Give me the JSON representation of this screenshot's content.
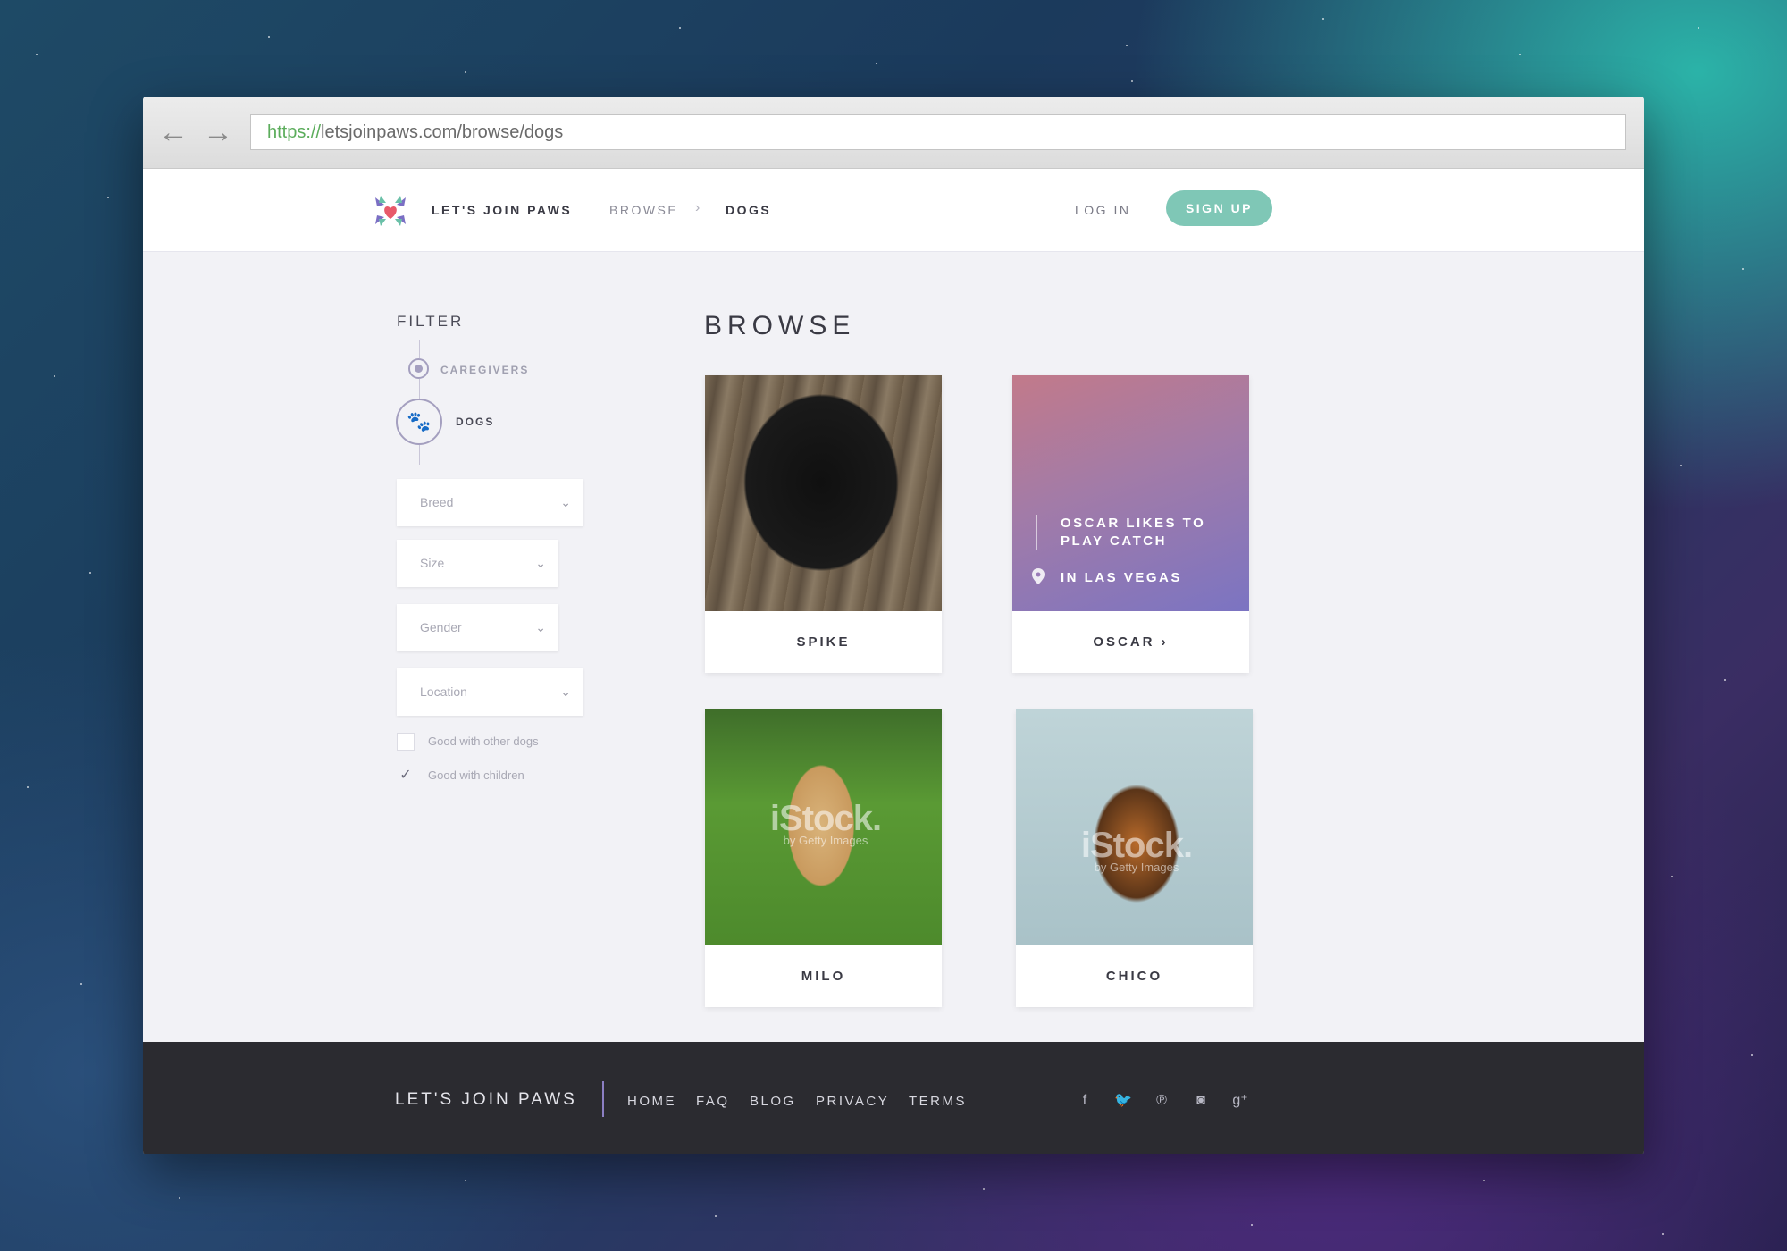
{
  "browser": {
    "url_scheme": "https://",
    "url_rest": "letsjoinpaws.com/browse/dogs"
  },
  "header": {
    "brand": "LET'S JOIN PAWS",
    "breadcrumb": [
      "BROWSE",
      "DOGS"
    ],
    "login": "LOG IN",
    "signup": "SIGN UP"
  },
  "filter": {
    "title": "FILTER",
    "steps": [
      "CAREGIVERS",
      "DOGS"
    ],
    "selects": {
      "breed": "Breed",
      "size": "Size",
      "gender": "Gender",
      "location": "Location"
    },
    "checkboxes": [
      {
        "label": "Good with other dogs",
        "checked": false
      },
      {
        "label": "Good with children",
        "checked": true
      }
    ]
  },
  "main": {
    "title": "BROWSE",
    "cards": [
      {
        "name": "SPIKE"
      },
      {
        "name": "OSCAR",
        "caption": "OSCAR LIKES TO PLAY CATCH",
        "location": "IN LAS VEGAS"
      },
      {
        "name": "MILO",
        "watermark": "iStock.",
        "watermark_sub": "by Getty Images"
      },
      {
        "name": "CHICO",
        "watermark": "iStock.",
        "watermark_sub": "by Getty Images"
      }
    ]
  },
  "footer": {
    "brand": "LET'S JOIN PAWS",
    "links": [
      "HOME",
      "FAQ",
      "BLOG",
      "PRIVACY",
      "TERMS"
    ],
    "social": [
      "facebook-icon",
      "twitter-icon",
      "pinterest-icon",
      "instagram-icon",
      "google-plus-icon"
    ]
  },
  "colors": {
    "accent": "#7fc7b6",
    "purple": "#8c7fc3",
    "footer_bg": "#2b2b30"
  }
}
